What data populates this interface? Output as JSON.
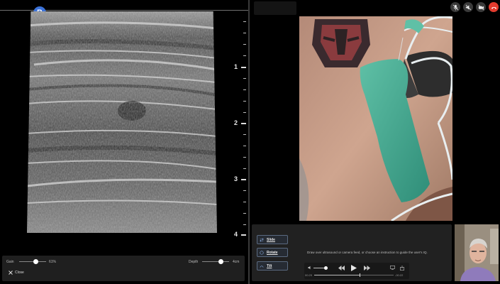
{
  "ultrasound": {
    "mode_badge": "B",
    "depth_scale": [
      "1",
      "2",
      "3",
      "4"
    ],
    "controls": {
      "gain_label": "Gain",
      "gain_value": "61%",
      "gain_level": 0.61,
      "depth_label": "Depth",
      "depth_value": "4cm",
      "depth_level": 0.7,
      "close_label": "Close"
    }
  },
  "call": {
    "toolbar_icons": [
      "mic-off-icon",
      "speaker-off-icon",
      "camera-off-icon",
      "end-call-icon"
    ],
    "colors": {
      "end_call": "#e23b2e",
      "badge": "#3b72d9"
    }
  },
  "guidance": {
    "buttons": [
      {
        "label": "Slide",
        "icon": "slide-arrows-icon"
      },
      {
        "label": "Rotate",
        "icon": "rotate-icon"
      },
      {
        "label": "Tilt",
        "icon": "tilt-icon"
      }
    ],
    "instruction": "Draw over ultrasound or camera feed, or choose an instruction to guide the user's IQ.",
    "playback": {
      "current_time": "00:29",
      "remaining_time": "-00:22",
      "progress": 0.57
    }
  }
}
